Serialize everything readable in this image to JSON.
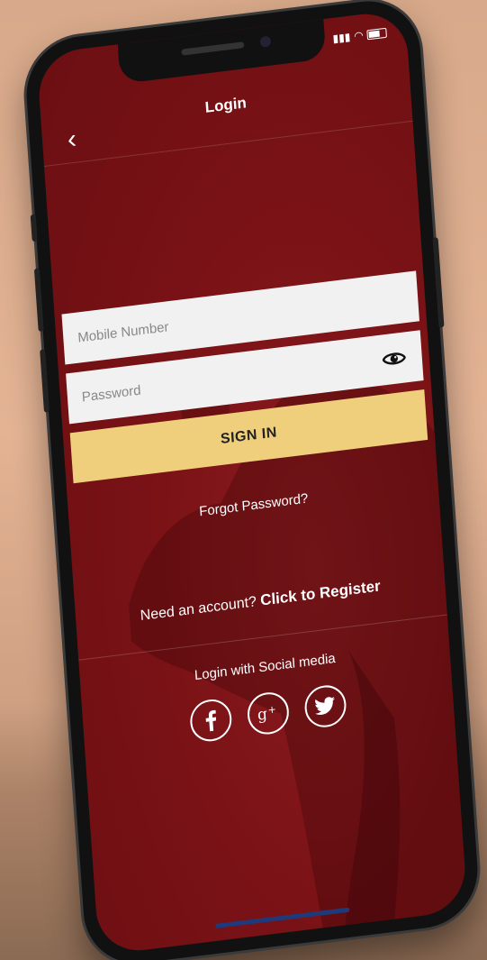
{
  "header": {
    "title": "Login",
    "back_icon": "chevron-left-icon"
  },
  "form": {
    "mobile_placeholder": "Mobile Number",
    "password_placeholder": "Password",
    "password_toggle_icon": "eye-icon",
    "signin_label": "SIGN IN"
  },
  "links": {
    "forgot_password": "Forgot Password?",
    "register_prompt": "Need an account?",
    "register_link": "Click to Register"
  },
  "social": {
    "title": "Login with Social media",
    "icons": [
      "facebook-icon",
      "google-plus-icon",
      "twitter-icon"
    ]
  },
  "colors": {
    "background": "#7a1216",
    "button": "#f0cf7c",
    "field": "#f1f1f1"
  }
}
